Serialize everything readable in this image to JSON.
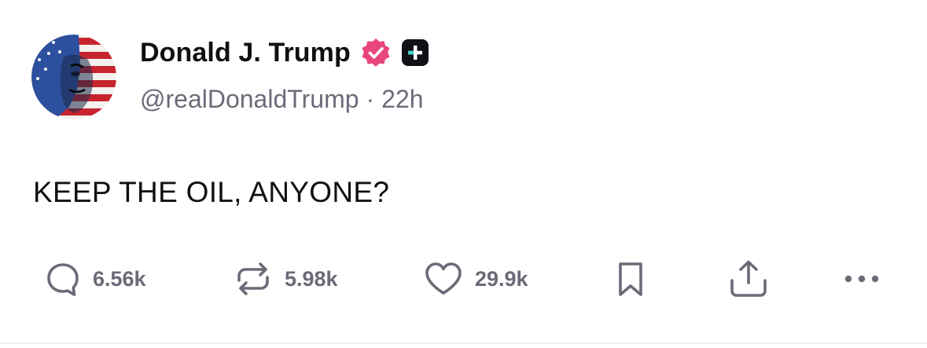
{
  "post": {
    "author": {
      "display_name": "Donald J. Trump",
      "handle": "@realDonaldTrump",
      "verified_icon": "verified-badge-icon",
      "plus_icon": "plus-square-icon"
    },
    "separator": "·",
    "time_ago": "22h",
    "text": "KEEP THE OIL, ANYONE?",
    "actions": {
      "replies": "6.56k",
      "reposts": "5.98k",
      "likes": "29.9k"
    }
  },
  "colors": {
    "verified_badge": "#e8467c",
    "icon_gray": "#6b6b78",
    "text": "#101014"
  }
}
